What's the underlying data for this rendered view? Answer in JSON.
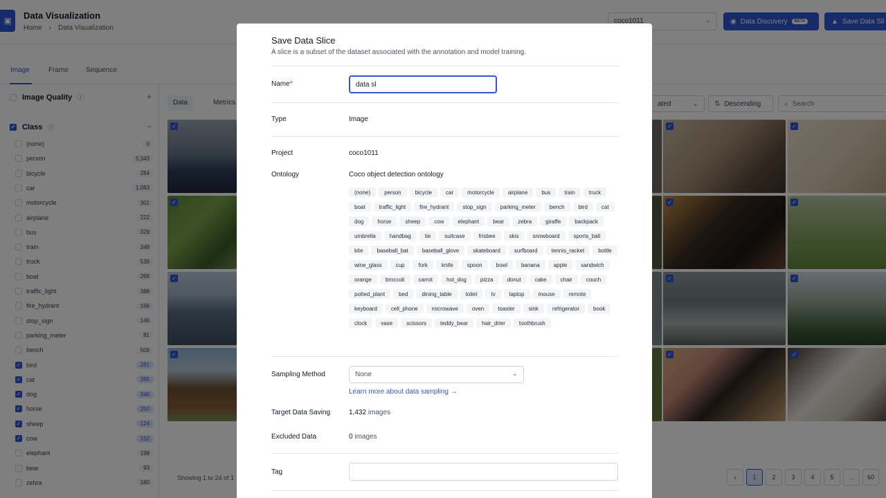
{
  "header": {
    "title": "Data Visualization",
    "breadcrumb_home": "Home",
    "breadcrumb_sep": "›",
    "breadcrumb_current": "Data Visualization",
    "project_select": "coco1011",
    "data_discovery_label": "Data Discovery",
    "beta_badge": "BETA",
    "save_slice_label": "Save Data Sli"
  },
  "tabs": [
    "Image",
    "Frame",
    "Sequence"
  ],
  "sidebar": {
    "image_quality_label": "Image Quality",
    "class_label": "Class",
    "classes": [
      {
        "name": "(none)",
        "count": "0",
        "checked": false
      },
      {
        "name": "person",
        "count": "5,343",
        "checked": false
      },
      {
        "name": "bicycle",
        "count": "284",
        "checked": false
      },
      {
        "name": "car",
        "count": "1,083",
        "checked": false
      },
      {
        "name": "motorcycle",
        "count": "301",
        "checked": false
      },
      {
        "name": "airplane",
        "count": "222",
        "checked": false
      },
      {
        "name": "bus",
        "count": "329",
        "checked": false
      },
      {
        "name": "train",
        "count": "349",
        "checked": false
      },
      {
        "name": "truck",
        "count": "539",
        "checked": false
      },
      {
        "name": "boat",
        "count": "268",
        "checked": false
      },
      {
        "name": "traffic_light",
        "count": "388",
        "checked": false
      },
      {
        "name": "fire_hydrant",
        "count": "166",
        "checked": false
      },
      {
        "name": "stop_sign",
        "count": "146",
        "checked": false
      },
      {
        "name": "parking_meter",
        "count": "81",
        "checked": false
      },
      {
        "name": "bench",
        "count": "509",
        "checked": false
      },
      {
        "name": "bird",
        "count": "281",
        "checked": true
      },
      {
        "name": "cat",
        "count": "385",
        "checked": true
      },
      {
        "name": "dog",
        "count": "346",
        "checked": true
      },
      {
        "name": "horse",
        "count": "250",
        "checked": true
      },
      {
        "name": "sheep",
        "count": "124",
        "checked": true
      },
      {
        "name": "cow",
        "count": "150",
        "checked": true
      },
      {
        "name": "elephant",
        "count": "198",
        "checked": false
      },
      {
        "name": "bear",
        "count": "93",
        "checked": false
      },
      {
        "name": "zebra",
        "count": "180",
        "checked": false
      }
    ]
  },
  "grid_toolbar": {
    "data_tab": "Data",
    "metrics_tab": "Metrics",
    "sort_field": "ated",
    "order": "Descending",
    "search_placeholder": "Search"
  },
  "footer": {
    "showing": "Showing 1 to 24 of 1",
    "pages": [
      "‹",
      "1",
      "2",
      "3",
      "4",
      "5",
      "...",
      "60"
    ]
  },
  "modal": {
    "title": "Save Data Slice",
    "subtitle": "A slice is a subset of the dataset associated with the annotation and model training.",
    "name_label": "Name",
    "required_mark": "*",
    "name_value": "data sl",
    "type_label": "Type",
    "type_value": "Image",
    "project_label": "Project",
    "project_value": "coco1011",
    "ontology_label": "Ontology",
    "ontology_value": "Coco object detection ontology",
    "ontology_classes": [
      "(none)",
      "person",
      "bicycle",
      "car",
      "motorcycle",
      "airplane",
      "bus",
      "train",
      "truck",
      "boat",
      "traffic_light",
      "fire_hydrant",
      "stop_sign",
      "parking_meter",
      "bench",
      "bird",
      "cat",
      "dog",
      "horse",
      "sheep",
      "cow",
      "elephant",
      "bear",
      "zebra",
      "giraffe",
      "backpack",
      "umbrella",
      "handbag",
      "tie",
      "suitcase",
      "frisbee",
      "skis",
      "snowboard",
      "sports_ball",
      "kite",
      "baseball_bat",
      "baseball_glove",
      "skateboard",
      "surfboard",
      "tennis_racket",
      "bottle",
      "wine_glass",
      "cup",
      "fork",
      "knife",
      "spoon",
      "bowl",
      "banana",
      "apple",
      "sandwich",
      "orange",
      "broccoli",
      "carrot",
      "hot_dog",
      "pizza",
      "donut",
      "cake",
      "chair",
      "couch",
      "potted_plant",
      "bed",
      "dining_table",
      "toilet",
      "tv",
      "laptop",
      "mouse",
      "remote",
      "keyboard",
      "cell_phone",
      "microwave",
      "oven",
      "toaster",
      "sink",
      "refrigerator",
      "book",
      "clock",
      "vase",
      "scissors",
      "teddy_bear",
      "hair_drier",
      "toothbrush"
    ],
    "sampling_label": "Sampling Method",
    "sampling_value": "None",
    "sampling_link": "Learn more about data sampling →",
    "target_label": "Target Data Saving",
    "target_count": "1,432",
    "target_unit": "images",
    "excluded_label": "Excluded Data",
    "excluded_count": "0",
    "excluded_unit": "images",
    "tag_label": "Tag"
  },
  "colors": {
    "primary": "#2f55d4",
    "overlay": "rgba(0,0,0,0.5)"
  }
}
